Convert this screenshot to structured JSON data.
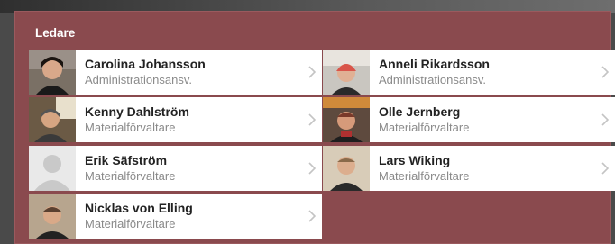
{
  "section": {
    "title": "Ledare"
  },
  "leaders": [
    {
      "name": "Carolina Johansson",
      "role": "Administrationsansv.",
      "photo_icon": "person-photo"
    },
    {
      "name": "Anneli Rikardsson",
      "role": "Administrationsansv.",
      "photo_icon": "person-photo"
    },
    {
      "name": "Kenny Dahlström",
      "role": "Materialförvaltare",
      "photo_icon": "person-photo"
    },
    {
      "name": "Olle Jernberg",
      "role": "Materialförvaltare",
      "photo_icon": "person-photo"
    },
    {
      "name": "Erik Säfström",
      "role": "Materialförvaltare",
      "photo_icon": "placeholder-avatar"
    },
    {
      "name": "Lars Wiking",
      "role": "Materialförvaltare",
      "photo_icon": "person-photo"
    },
    {
      "name": "Nicklas von Elling",
      "role": "Materialförvaltare",
      "photo_icon": "person-photo"
    }
  ],
  "colors": {
    "panel": "#8a4a4e",
    "card": "#ffffff",
    "name": "#222222",
    "role": "#8a8a8a",
    "chevron": "#c4c4c4"
  }
}
